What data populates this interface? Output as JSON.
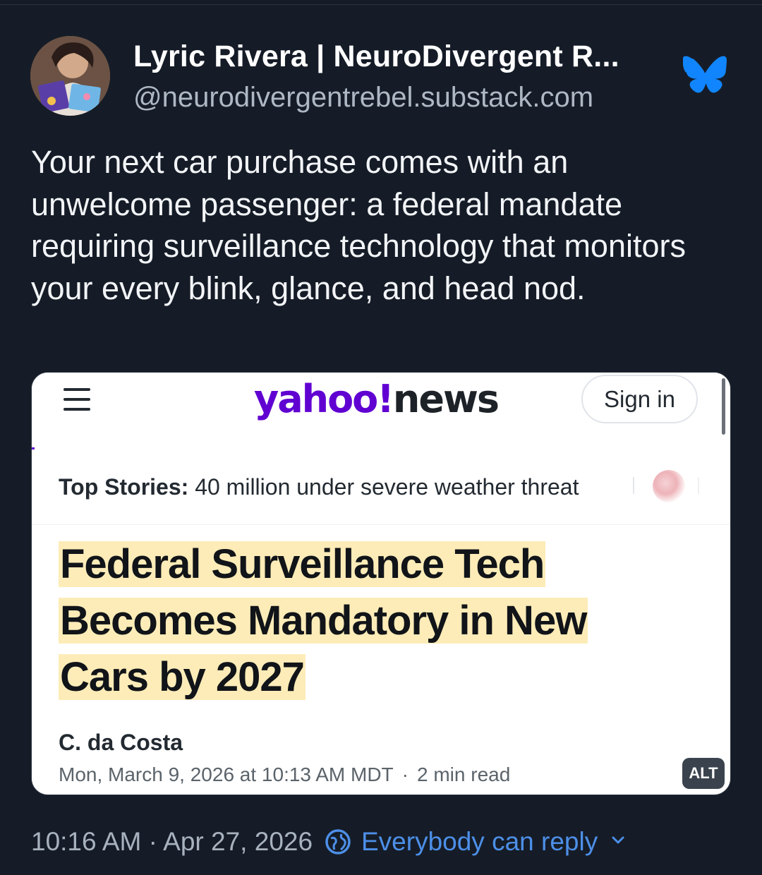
{
  "author": {
    "display_name": "Lyric Rivera | NeuroDivergent R...",
    "handle": "@neurodivergentrebel.substack.com",
    "avatar_icon": "avatar-photo"
  },
  "platform_icon": "bluesky-butterfly-icon",
  "post": {
    "text": "Your next car purchase comes with an unwelcome passenger: a federal mandate requiring surveillance technology that monitors your every blink, glance, and head nod."
  },
  "embed": {
    "logo_primary": "yahoo!",
    "logo_secondary": "news",
    "sign_in_label": "Sign in",
    "top_stories_label": "Top Stories:",
    "top_stories_text": "40 million under severe weather threat",
    "headline_line1": "Federal Surveillance Tech",
    "headline_line2": "Becomes Mandatory in New",
    "headline_line3": "Cars by 2027",
    "author": "C. da Costa",
    "date": "Mon, March 9, 2026 at 10:13 AM MDT",
    "separator": "·",
    "read_time": "2 min read",
    "alt_badge": "ALT"
  },
  "footer": {
    "timestamp": "10:16 AM · Apr 27, 2026",
    "reply_setting": "Everybody can reply"
  },
  "colors": {
    "background": "#151c27",
    "accent_blue": "#4d8fe8",
    "yahoo_purple": "#6001d2",
    "bluesky_blue": "#1185fe",
    "highlight": "#fdecb8"
  }
}
